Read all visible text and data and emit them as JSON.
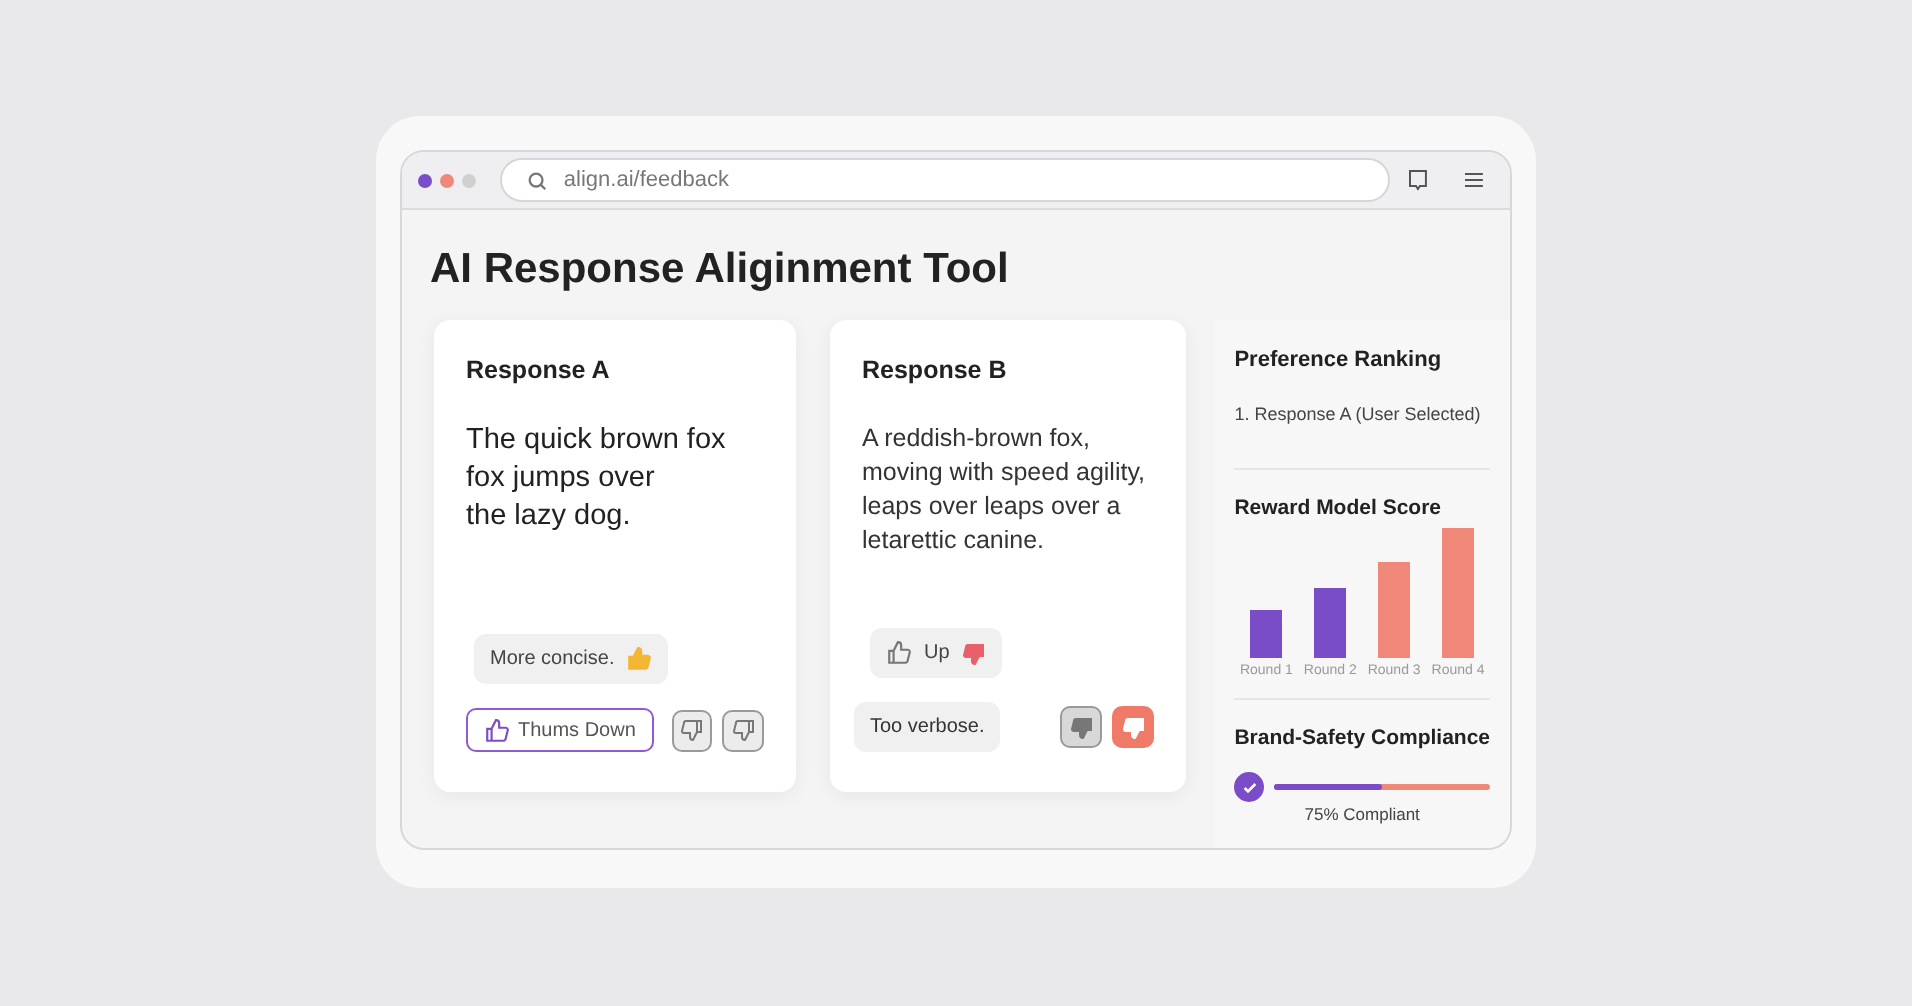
{
  "browser": {
    "url": "align.ai/feedback"
  },
  "title": "AI Response Aliginment Tool",
  "responses": [
    {
      "heading": "Response A",
      "lines": [
        "The quick brown fox",
        "fox jumps over",
        "the lazy dog."
      ],
      "large": true,
      "chip": {
        "text": "More concise.",
        "kind": "praise"
      },
      "action": {
        "kind": "outline",
        "text": "Thums Down"
      },
      "votes": [
        {
          "kind": "grey-outline"
        },
        {
          "kind": "grey-outline"
        }
      ]
    },
    {
      "heading": "Response B",
      "lines": [
        "A reddish-brown fox,",
        "moving with speed agility,",
        "leaps over leaps over a",
        "letarettic canine."
      ],
      "large": false,
      "chip": {
        "text": "Up",
        "kind": "vote"
      },
      "note": "Too verbose.",
      "votes": [
        {
          "kind": "grey-filled"
        },
        {
          "kind": "red-filled"
        }
      ]
    }
  ],
  "panel": {
    "ranking": {
      "heading": "Preference Ranking",
      "items": [
        "1. Response A (User Selected)"
      ]
    },
    "reward": {
      "heading": "Reward Model Score",
      "categories": [
        "Round 1",
        "Round 2",
        "Round 3",
        "Round 4"
      ]
    },
    "compliance": {
      "heading": "Brand-Safety Compliance",
      "checked": true,
      "level": 0.5,
      "reading": "75% Compliant"
    }
  }
}
